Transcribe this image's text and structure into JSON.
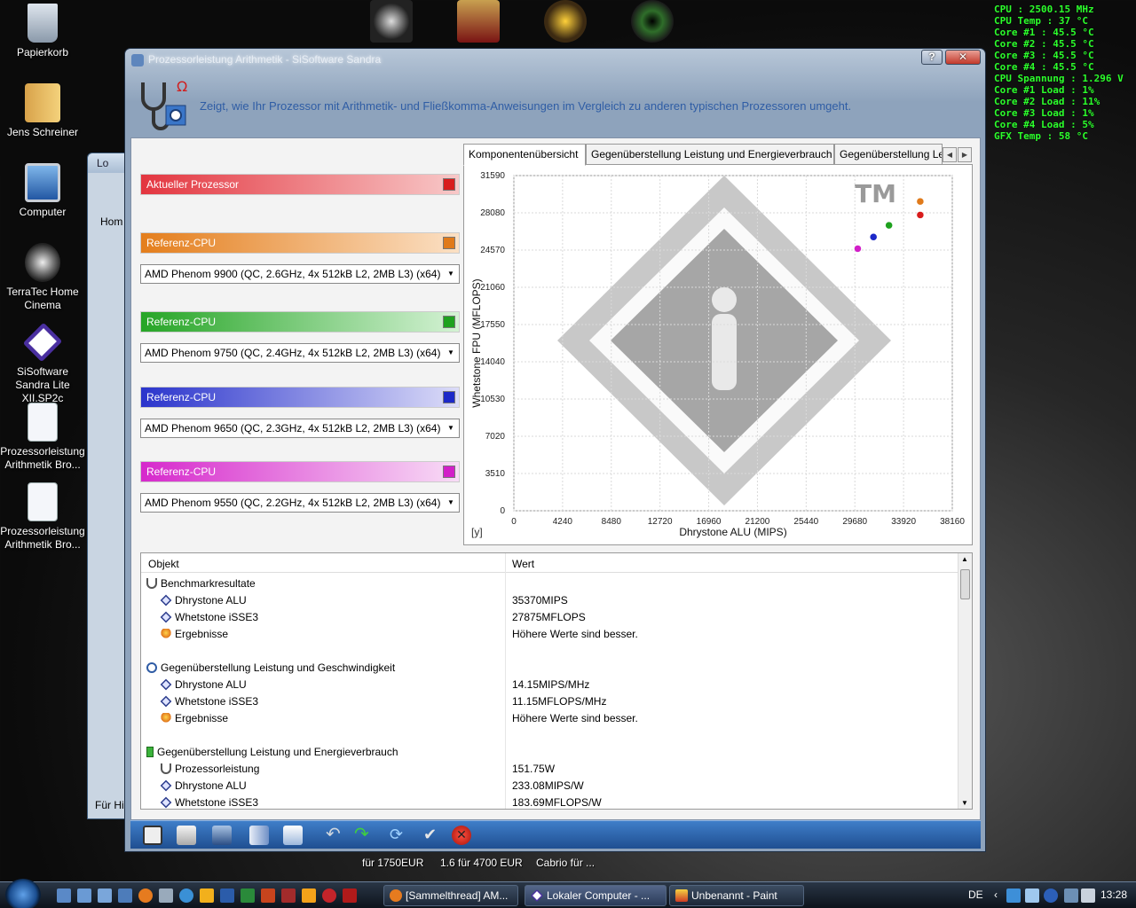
{
  "desktop": {
    "icons": [
      {
        "label": "Papierkorb"
      },
      {
        "label": "Jens Schreiner"
      },
      {
        "label": "Computer"
      },
      {
        "label": "TerraTec Home Cinema"
      },
      {
        "label": "SiSoftware Sandra Lite XII.SP2c"
      },
      {
        "label": "Prozessorleistung Arithmetik Bro..."
      },
      {
        "label": "Prozessorleistung Arithmetik Bro..."
      }
    ],
    "game_icons": [
      "steam-icon",
      "vegas2-icon",
      "stalker-icon",
      "fear-icon"
    ],
    "sysmon": [
      "CPU : 2500.15 MHz",
      "CPU Temp : 37 °C",
      "Core #1 : 45.5 °C",
      "Core #2 : 45.5 °C",
      "Core #3 : 45.5 °C",
      "Core #4 : 45.5 °C",
      "CPU Spannung : 1.296 V",
      "Core #1 Load : 1%",
      "Core #2 Load : 11%",
      "Core #3 Load : 1%",
      "Core #4 Load : 5%",
      "GFX Temp : 58 °C"
    ],
    "ad_texts": [
      "für 1750EUR",
      "1.6 für 4700 EUR",
      "Cabrio für ..."
    ]
  },
  "background_window": {
    "title": "Lo",
    "tab": "Hom",
    "footer": "Für Hi"
  },
  "window": {
    "title": "Prozessorleistung Arithmetik - SiSoftware Sandra",
    "help_label": "?",
    "close_label": "✕",
    "description": "Zeigt, wie Ihr Prozessor mit Arithmetik- und Fließkomma-Anweisungen im Vergleich zu anderen typischen Prozessoren umgeht.",
    "accent": "#2f5da5"
  },
  "left": {
    "current": {
      "label": "Aktueller Prozessor",
      "color": "#d81c1c"
    },
    "refs": [
      {
        "label": "Referenz-CPU",
        "color": "#e07a1a",
        "cpu": "AMD Phenom 9900 (QC, 2.6GHz, 4x 512kB L2, 2MB L3) (x64)"
      },
      {
        "label": "Referenz-CPU",
        "color": "#1ea11e",
        "cpu": "AMD Phenom 9750 (QC, 2.4GHz, 4x 512kB L2, 2MB L3) (x64)"
      },
      {
        "label": "Referenz-CPU",
        "color": "#1c28c8",
        "cpu": "AMD Phenom 9650 (QC, 2.3GHz, 4x 512kB L2, 2MB L3) (x64)"
      },
      {
        "label": "Referenz-CPU",
        "color": "#d21fc8",
        "cpu": "AMD Phenom 9550 (QC, 2.2GHz, 4x 512kB L2, 2MB L3) (x64)"
      }
    ]
  },
  "tabs": [
    {
      "label": "Komponentenübersicht"
    },
    {
      "label": "Gegenüberstellung Leistung und Energieverbrauch"
    },
    {
      "label": "Gegenüberstellung Leistung"
    }
  ],
  "chart_data": {
    "type": "scatter",
    "xlabel": "Dhrystone ALU (MIPS)",
    "ylabel": "Whetstone FPU (MFLOPS)",
    "corner_label": "[y]",
    "watermark": "TM",
    "xlim": [
      0,
      38160
    ],
    "ylim": [
      0,
      31590
    ],
    "xticks": [
      0,
      4240,
      8480,
      12720,
      16960,
      21200,
      25440,
      29680,
      33920,
      38160
    ],
    "yticks": [
      0,
      3510,
      7020,
      10530,
      14040,
      17550,
      21060,
      24570,
      28080,
      31590
    ],
    "grid": true,
    "series": [
      {
        "color": "#d81c1c",
        "x": 35370,
        "y": 27875
      },
      {
        "color": "#e07a1a",
        "x": 35370,
        "y": 29150
      },
      {
        "color": "#1ea11e",
        "x": 32650,
        "y": 26900
      },
      {
        "color": "#1c28c8",
        "x": 31300,
        "y": 25800
      },
      {
        "color": "#d21fc8",
        "x": 29930,
        "y": 24700
      }
    ]
  },
  "table": {
    "col_object": "Objekt",
    "col_value": "Wert",
    "rows": [
      {
        "indent": 0,
        "icon": "steth",
        "key": "Benchmarkresultate",
        "value": ""
      },
      {
        "indent": 1,
        "icon": "diamond",
        "key": "Dhrystone ALU",
        "value": "35370MIPS"
      },
      {
        "indent": 1,
        "icon": "diamond",
        "key": "Whetstone iSSE3",
        "value": "27875MFLOPS"
      },
      {
        "indent": 1,
        "icon": "bulb",
        "key": "Ergebnisse",
        "value": "Höhere Werte sind besser."
      },
      {
        "indent": 0,
        "icon": "clock",
        "key": "Gegenüberstellung Leistung und Geschwindigkeit",
        "value": ""
      },
      {
        "indent": 1,
        "icon": "diamond",
        "key": "Dhrystone ALU",
        "value": "14.15MIPS/MHz"
      },
      {
        "indent": 1,
        "icon": "diamond",
        "key": "Whetstone iSSE3",
        "value": "11.15MFLOPS/MHz"
      },
      {
        "indent": 1,
        "icon": "bulb",
        "key": "Ergebnisse",
        "value": "Höhere Werte sind besser."
      },
      {
        "indent": 0,
        "icon": "battery",
        "key": "Gegenüberstellung Leistung und Energieverbrauch",
        "value": ""
      },
      {
        "indent": 1,
        "icon": "steth",
        "key": "Prozessorleistung",
        "value": "151.75W"
      },
      {
        "indent": 1,
        "icon": "diamond",
        "key": "Dhrystone ALU",
        "value": "233.08MIPS/W"
      },
      {
        "indent": 1,
        "icon": "diamond",
        "key": "Whetstone iSSE3",
        "value": "183.69MFLOPS/W"
      }
    ]
  },
  "toolbar_icons": [
    "report-icon",
    "copy-icon",
    "save-icon",
    "chart-type-icon",
    "graph-icon",
    "back-icon",
    "forward-icon",
    "refresh-icon",
    "ok-icon",
    "cancel-icon"
  ],
  "taskbar": {
    "buttons": [
      {
        "label": "[Sammelthread] AM..."
      },
      {
        "label": "Lokaler Computer - ..."
      },
      {
        "label": "Unbenannt - Paint"
      }
    ],
    "lang": "DE",
    "clock": "13:28"
  }
}
